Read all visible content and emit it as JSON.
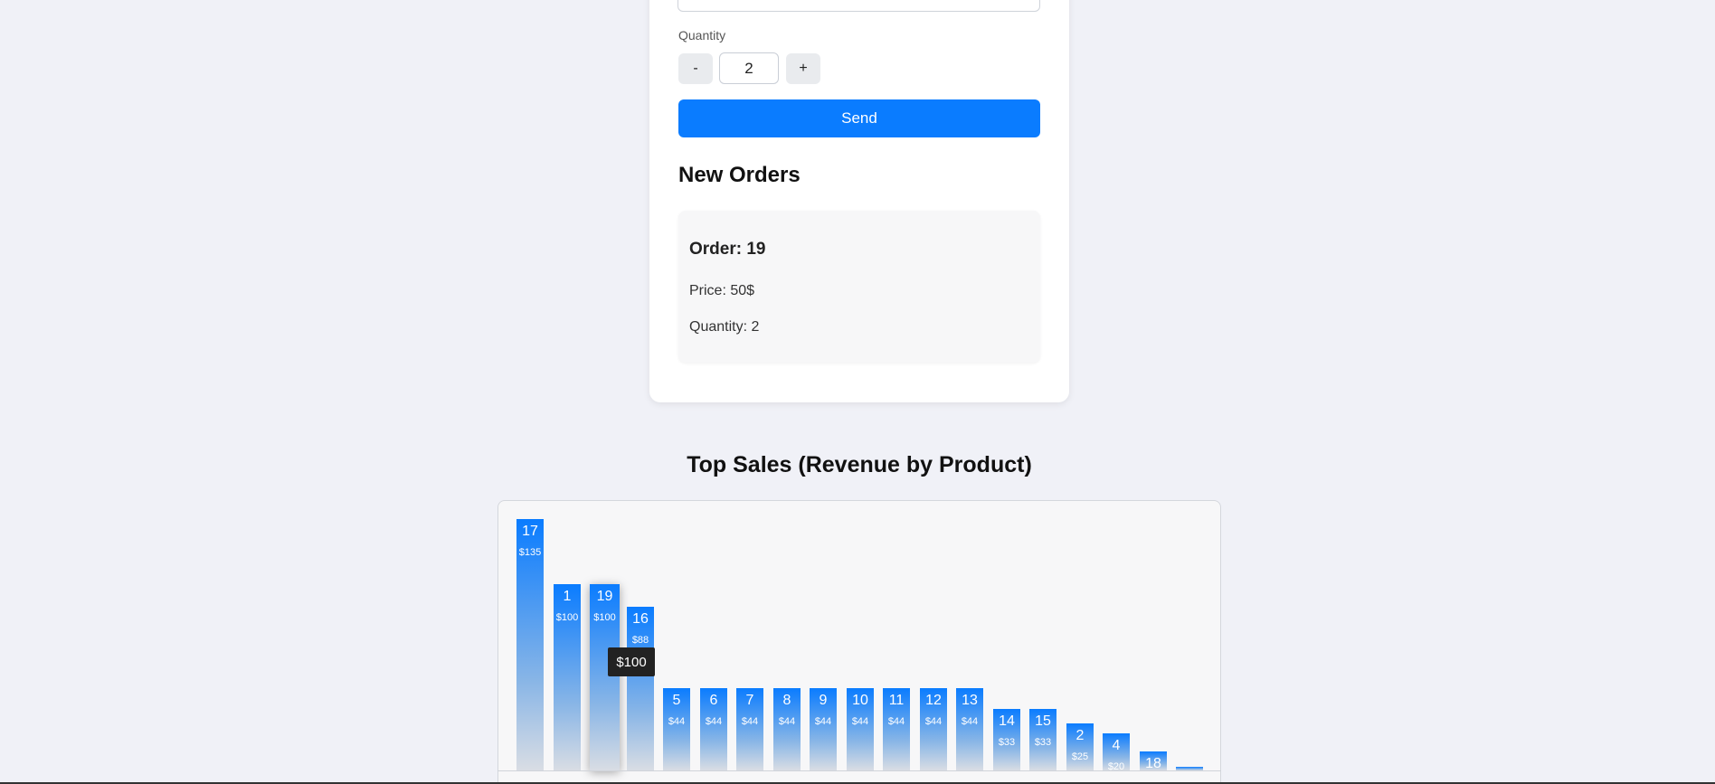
{
  "form": {
    "top_input_value": "",
    "quantity_label": "Quantity",
    "minus_label": "-",
    "plus_label": "+",
    "quantity_value": "2",
    "send_label": "Send"
  },
  "orders": {
    "heading": "New Orders",
    "items": [
      {
        "title": "Order: 19",
        "price": "Price: 50$",
        "quantity": "Quantity: 2"
      }
    ]
  },
  "colors": {
    "accent": "#0a7cff",
    "background": "#f0f1f7"
  },
  "chart_data": {
    "type": "bar",
    "title": "Top Sales (Revenue by Product)",
    "xlabel": "",
    "ylabel": "",
    "categories": [
      "17",
      "1",
      "19",
      "16",
      "5",
      "6",
      "7",
      "8",
      "9",
      "10",
      "11",
      "12",
      "13",
      "14",
      "15",
      "2",
      "4",
      "18",
      ""
    ],
    "values": [
      135,
      100,
      100,
      88,
      44,
      44,
      44,
      44,
      44,
      44,
      44,
      44,
      44,
      33,
      33,
      25,
      20,
      10,
      2
    ],
    "value_labels": [
      "$135",
      "$100",
      "$100",
      "$88",
      "$44",
      "$44",
      "$44",
      "$44",
      "$44",
      "$44",
      "$44",
      "$44",
      "$44",
      "$33",
      "$33",
      "$25",
      "$20",
      "",
      ""
    ],
    "hovered_index": 2,
    "tooltip": "$100",
    "grid": false
  }
}
